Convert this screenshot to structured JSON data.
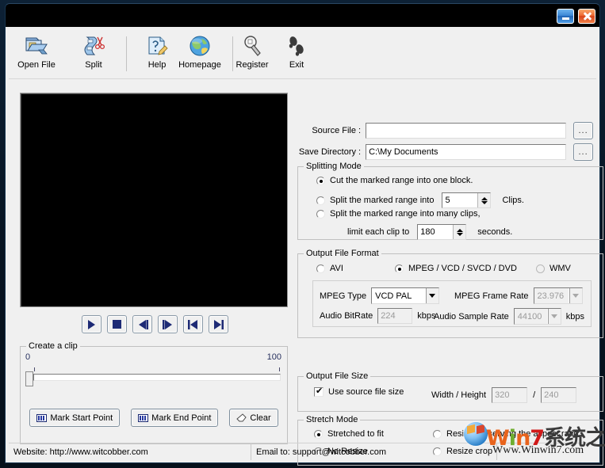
{
  "window": {
    "title": "",
    "minimize_label": "Minimize",
    "close_label": "Close"
  },
  "toolbar": {
    "items": [
      {
        "label": "Open File",
        "icon": "open-file-icon"
      },
      {
        "label": "Split",
        "icon": "split-icon"
      },
      {
        "label": "Help",
        "icon": "help-icon"
      },
      {
        "label": "Homepage",
        "icon": "homepage-icon"
      },
      {
        "label": "Register",
        "icon": "register-icon"
      },
      {
        "label": "Exit",
        "icon": "exit-icon"
      }
    ]
  },
  "transport": {
    "buttons": [
      {
        "name": "play-button",
        "icon": "play-icon"
      },
      {
        "name": "stop-button",
        "icon": "stop-icon"
      },
      {
        "name": "step-backward-button",
        "icon": "step-backward-icon"
      },
      {
        "name": "step-forward-button",
        "icon": "step-forward-icon"
      },
      {
        "name": "skip-to-start-button",
        "icon": "skip-start-icon"
      },
      {
        "name": "skip-to-end-button",
        "icon": "skip-end-icon"
      }
    ]
  },
  "clip": {
    "group_title": "Create a clip",
    "scale_min": "0",
    "scale_max": "100",
    "slider_value": 0,
    "mark_start_label": "Mark Start Point",
    "mark_end_label": "Mark End Point",
    "clear_label": "Clear"
  },
  "files": {
    "source_label": "Source File :",
    "source_value": "",
    "source_placeholder": "",
    "save_label": "Save Directory :",
    "save_value": "C:\\My Documents",
    "browse_label": "..."
  },
  "splitting_mode": {
    "group_title": "Splitting Mode",
    "option_one_block": "Cut the marked range into one block.",
    "option_into_clips_prefix": "Split the marked range into",
    "clips_count": "5",
    "option_into_clips_suffix": "Clips.",
    "option_many_clips": "Split the marked range into many clips,",
    "limit_prefix": "limit each clip to",
    "limit_seconds": "180",
    "limit_suffix": "seconds.",
    "selected": "one_block"
  },
  "output_format": {
    "group_title": "Output File Format",
    "avi_label": "AVI",
    "mpeg_label": "MPEG / VCD / SVCD / DVD",
    "wmv_label": "WMV",
    "selected": "mpeg",
    "mpeg_type_label": "MPEG Type",
    "mpeg_type_value": "VCD PAL",
    "frame_rate_label": "MPEG Frame Rate",
    "frame_rate_value": "23.976",
    "audio_bitrate_label": "Audio BitRate",
    "audio_bitrate_value": "224",
    "audio_bitrate_unit": "kbps",
    "audio_sample_label": "Audio Sample Rate",
    "audio_sample_value": "44100",
    "audio_sample_unit": "kbps"
  },
  "output_size": {
    "group_title": "Output File Size",
    "use_source_label": "Use source file size",
    "use_source_checked": true,
    "wh_label": "Width / Height",
    "width_value": "320",
    "separator": "/",
    "height_value": "240"
  },
  "stretch_mode": {
    "group_title": "Stretch Mode",
    "stretched_label": "Stretched to fit",
    "no_resize_label": "No Resize",
    "aspect_label": "Resize preserving the aspect ratio",
    "crop_label": "Resize crop",
    "selected": "stretched"
  },
  "statusbar": {
    "website": "Website: http://www.witcobber.com",
    "email": "Email to: support@witcobber.com",
    "extra": ""
  },
  "watermark": {
    "part_w": "W",
    "part_i": "i",
    "part_n": "n",
    "part_7": "7",
    "part_cn": "系统之家",
    "subtitle": "Www.Winwin7.com"
  },
  "colors": {
    "accent": "#27305e",
    "window_chrome": "#0d2135",
    "client_bg": "#f0f0f0",
    "video_bg": "#000000",
    "close_button": "#ef6a33",
    "minimize_button": "#3b87d6"
  }
}
